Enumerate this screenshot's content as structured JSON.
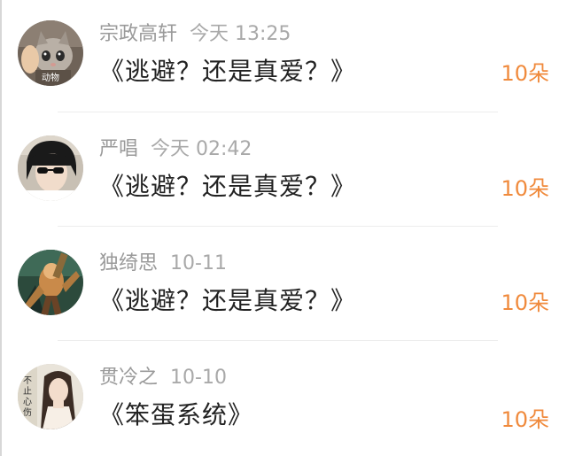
{
  "items": [
    {
      "name": "宗政高轩",
      "time": "今天 13:25",
      "title": "《逃避？还是真爱？》",
      "count": "10朵",
      "avatar_icon": "kitten-avatar",
      "avatar_text": "动物"
    },
    {
      "name": "严唱",
      "time": "今天 02:42",
      "title": "《逃避？还是真爱？》",
      "count": "10朵",
      "avatar_icon": "sunglasses-person-avatar"
    },
    {
      "name": "独绮思",
      "time": "10-11",
      "title": "《逃避？还是真爱？》",
      "count": "10朵",
      "avatar_icon": "game-character-avatar"
    },
    {
      "name": "贯冷之",
      "time": "10-10",
      "title": "《笨蛋系统》",
      "count": "10朵",
      "avatar_icon": "woman-portrait-avatar",
      "avatar_text": "不止心伤"
    }
  ],
  "colors": {
    "count": "#f08a3c",
    "name": "#9a9a9a",
    "title": "#222222"
  }
}
